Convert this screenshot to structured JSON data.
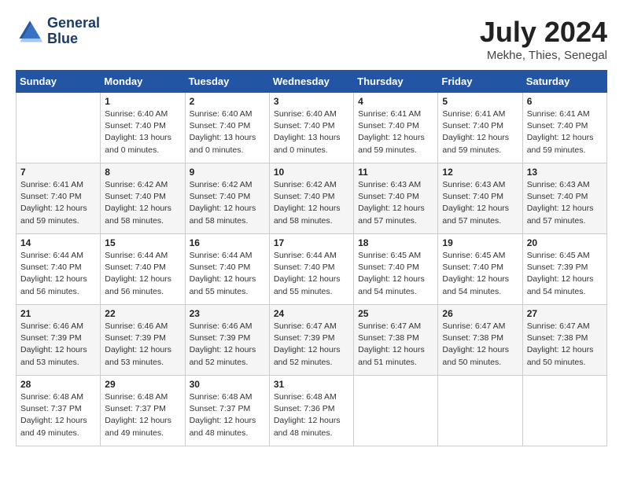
{
  "header": {
    "logo_line1": "General",
    "logo_line2": "Blue",
    "month_year": "July 2024",
    "location": "Mekhe, Thies, Senegal"
  },
  "columns": [
    "Sunday",
    "Monday",
    "Tuesday",
    "Wednesday",
    "Thursday",
    "Friday",
    "Saturday"
  ],
  "weeks": [
    [
      {
        "day": "",
        "info": ""
      },
      {
        "day": "1",
        "info": "Sunrise: 6:40 AM\nSunset: 7:40 PM\nDaylight: 13 hours\nand 0 minutes."
      },
      {
        "day": "2",
        "info": "Sunrise: 6:40 AM\nSunset: 7:40 PM\nDaylight: 13 hours\nand 0 minutes."
      },
      {
        "day": "3",
        "info": "Sunrise: 6:40 AM\nSunset: 7:40 PM\nDaylight: 13 hours\nand 0 minutes."
      },
      {
        "day": "4",
        "info": "Sunrise: 6:41 AM\nSunset: 7:40 PM\nDaylight: 12 hours\nand 59 minutes."
      },
      {
        "day": "5",
        "info": "Sunrise: 6:41 AM\nSunset: 7:40 PM\nDaylight: 12 hours\nand 59 minutes."
      },
      {
        "day": "6",
        "info": "Sunrise: 6:41 AM\nSunset: 7:40 PM\nDaylight: 12 hours\nand 59 minutes."
      }
    ],
    [
      {
        "day": "7",
        "info": "Sunrise: 6:41 AM\nSunset: 7:40 PM\nDaylight: 12 hours\nand 59 minutes."
      },
      {
        "day": "8",
        "info": "Sunrise: 6:42 AM\nSunset: 7:40 PM\nDaylight: 12 hours\nand 58 minutes."
      },
      {
        "day": "9",
        "info": "Sunrise: 6:42 AM\nSunset: 7:40 PM\nDaylight: 12 hours\nand 58 minutes."
      },
      {
        "day": "10",
        "info": "Sunrise: 6:42 AM\nSunset: 7:40 PM\nDaylight: 12 hours\nand 58 minutes."
      },
      {
        "day": "11",
        "info": "Sunrise: 6:43 AM\nSunset: 7:40 PM\nDaylight: 12 hours\nand 57 minutes."
      },
      {
        "day": "12",
        "info": "Sunrise: 6:43 AM\nSunset: 7:40 PM\nDaylight: 12 hours\nand 57 minutes."
      },
      {
        "day": "13",
        "info": "Sunrise: 6:43 AM\nSunset: 7:40 PM\nDaylight: 12 hours\nand 57 minutes."
      }
    ],
    [
      {
        "day": "14",
        "info": "Sunrise: 6:44 AM\nSunset: 7:40 PM\nDaylight: 12 hours\nand 56 minutes."
      },
      {
        "day": "15",
        "info": "Sunrise: 6:44 AM\nSunset: 7:40 PM\nDaylight: 12 hours\nand 56 minutes."
      },
      {
        "day": "16",
        "info": "Sunrise: 6:44 AM\nSunset: 7:40 PM\nDaylight: 12 hours\nand 55 minutes."
      },
      {
        "day": "17",
        "info": "Sunrise: 6:44 AM\nSunset: 7:40 PM\nDaylight: 12 hours\nand 55 minutes."
      },
      {
        "day": "18",
        "info": "Sunrise: 6:45 AM\nSunset: 7:40 PM\nDaylight: 12 hours\nand 54 minutes."
      },
      {
        "day": "19",
        "info": "Sunrise: 6:45 AM\nSunset: 7:40 PM\nDaylight: 12 hours\nand 54 minutes."
      },
      {
        "day": "20",
        "info": "Sunrise: 6:45 AM\nSunset: 7:39 PM\nDaylight: 12 hours\nand 54 minutes."
      }
    ],
    [
      {
        "day": "21",
        "info": "Sunrise: 6:46 AM\nSunset: 7:39 PM\nDaylight: 12 hours\nand 53 minutes."
      },
      {
        "day": "22",
        "info": "Sunrise: 6:46 AM\nSunset: 7:39 PM\nDaylight: 12 hours\nand 53 minutes."
      },
      {
        "day": "23",
        "info": "Sunrise: 6:46 AM\nSunset: 7:39 PM\nDaylight: 12 hours\nand 52 minutes."
      },
      {
        "day": "24",
        "info": "Sunrise: 6:47 AM\nSunset: 7:39 PM\nDaylight: 12 hours\nand 52 minutes."
      },
      {
        "day": "25",
        "info": "Sunrise: 6:47 AM\nSunset: 7:38 PM\nDaylight: 12 hours\nand 51 minutes."
      },
      {
        "day": "26",
        "info": "Sunrise: 6:47 AM\nSunset: 7:38 PM\nDaylight: 12 hours\nand 50 minutes."
      },
      {
        "day": "27",
        "info": "Sunrise: 6:47 AM\nSunset: 7:38 PM\nDaylight: 12 hours\nand 50 minutes."
      }
    ],
    [
      {
        "day": "28",
        "info": "Sunrise: 6:48 AM\nSunset: 7:37 PM\nDaylight: 12 hours\nand 49 minutes."
      },
      {
        "day": "29",
        "info": "Sunrise: 6:48 AM\nSunset: 7:37 PM\nDaylight: 12 hours\nand 49 minutes."
      },
      {
        "day": "30",
        "info": "Sunrise: 6:48 AM\nSunset: 7:37 PM\nDaylight: 12 hours\nand 48 minutes."
      },
      {
        "day": "31",
        "info": "Sunrise: 6:48 AM\nSunset: 7:36 PM\nDaylight: 12 hours\nand 48 minutes."
      },
      {
        "day": "",
        "info": ""
      },
      {
        "day": "",
        "info": ""
      },
      {
        "day": "",
        "info": ""
      }
    ]
  ]
}
